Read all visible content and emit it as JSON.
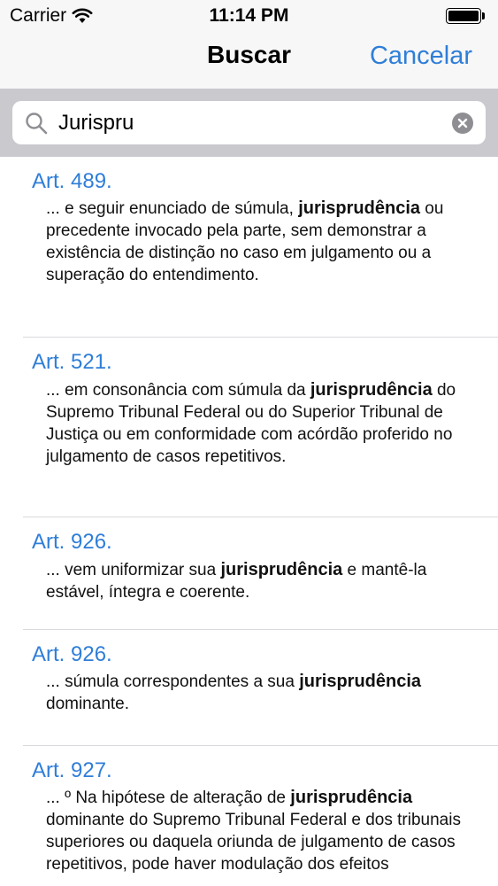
{
  "status_bar": {
    "carrier": "Carrier",
    "time": "11:14 PM",
    "icons": [
      "wifi-icon",
      "battery-icon"
    ]
  },
  "nav": {
    "title": "Buscar",
    "cancel_label": "Cancelar"
  },
  "search": {
    "value": "Jurispru",
    "icons": [
      "search-icon",
      "clear-icon"
    ]
  },
  "results": [
    {
      "title": "Art. 489.",
      "before": "... e seguir enunciado de súmula,",
      "highlight": "jurisprudência",
      "after": "ou precedente invocado pela parte, sem demonstrar a existência de distinção no caso em julgamento ou a superação do entendimento."
    },
    {
      "title": "Art. 521.",
      "before": "...  em consonância com súmula da",
      "highlight": "jurisprudência",
      "after": "do Supremo Tribunal Federal ou do Superior Tribunal de Justiça ou em conformidade com acórdão proferido no julgamento de casos repetitivos."
    },
    {
      "title": "Art. 926.",
      "before": "... vem uniformizar sua",
      "highlight": "jurisprudência",
      "after": "e mantê-la estável, íntegra e coerente."
    },
    {
      "title": "Art. 926.",
      "before": "...  súmula correspondentes a sua",
      "highlight": "jurisprudência",
      "after": "dominante."
    },
    {
      "title": "Art. 927.",
      "before": "... º Na hipótese de alteração de",
      "highlight": "jurisprudência",
      "after": "dominante do Supremo Tribunal Federal e dos tribunais superiores ou daquela oriunda de julgamento de casos repetitivos, pode haver modulação dos efeitos"
    }
  ],
  "colors": {
    "accent": "#2f7ed8",
    "bar_background": "#f7f7f7",
    "search_tray": "#c9c9ce"
  }
}
